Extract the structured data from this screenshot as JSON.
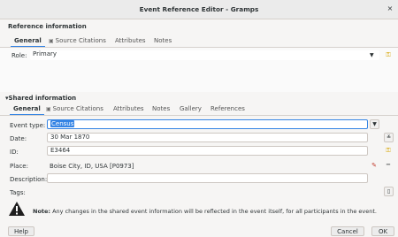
{
  "window": {
    "title": "Event Reference Editor - Gramps",
    "close_label": "×"
  },
  "reference": {
    "section_title": "Reference information",
    "tabs": [
      {
        "label": "General",
        "active": true
      },
      {
        "label": "Source Citations",
        "active": false,
        "icon": "citation-icon"
      },
      {
        "label": "Attributes",
        "active": false
      },
      {
        "label": "Notes",
        "active": false
      }
    ],
    "role_label": "Role:",
    "role_value": "Primary"
  },
  "shared": {
    "section_title": "Shared information",
    "expander": "▾",
    "tabs": [
      {
        "label": "General",
        "active": true
      },
      {
        "label": "Source Citations",
        "active": false,
        "icon": "citation-icon"
      },
      {
        "label": "Attributes",
        "active": false
      },
      {
        "label": "Notes",
        "active": false
      },
      {
        "label": "Gallery",
        "active": false
      },
      {
        "label": "References",
        "active": false
      }
    ],
    "event_type_label": "Event type:",
    "event_type_value": "Census",
    "date_label": "Date:",
    "date_value": "30 Mar 1870",
    "id_label": "ID:",
    "id_value": "E3464",
    "place_label": "Place:",
    "place_value": "Boise City, ID, USA [P0973]",
    "description_label": "Description:",
    "description_value": "",
    "tags_label": "Tags:"
  },
  "note": {
    "bold": "Note:",
    "text": " Any changes in the shared event information will be reflected in the event itself, for all participants in the event."
  },
  "buttons": {
    "help": "Help",
    "cancel": "Cancel",
    "ok": "OK"
  },
  "colors": {
    "accent": "#3584e4",
    "warning": "#1e1e1e",
    "key_icon": "#d6a400"
  }
}
